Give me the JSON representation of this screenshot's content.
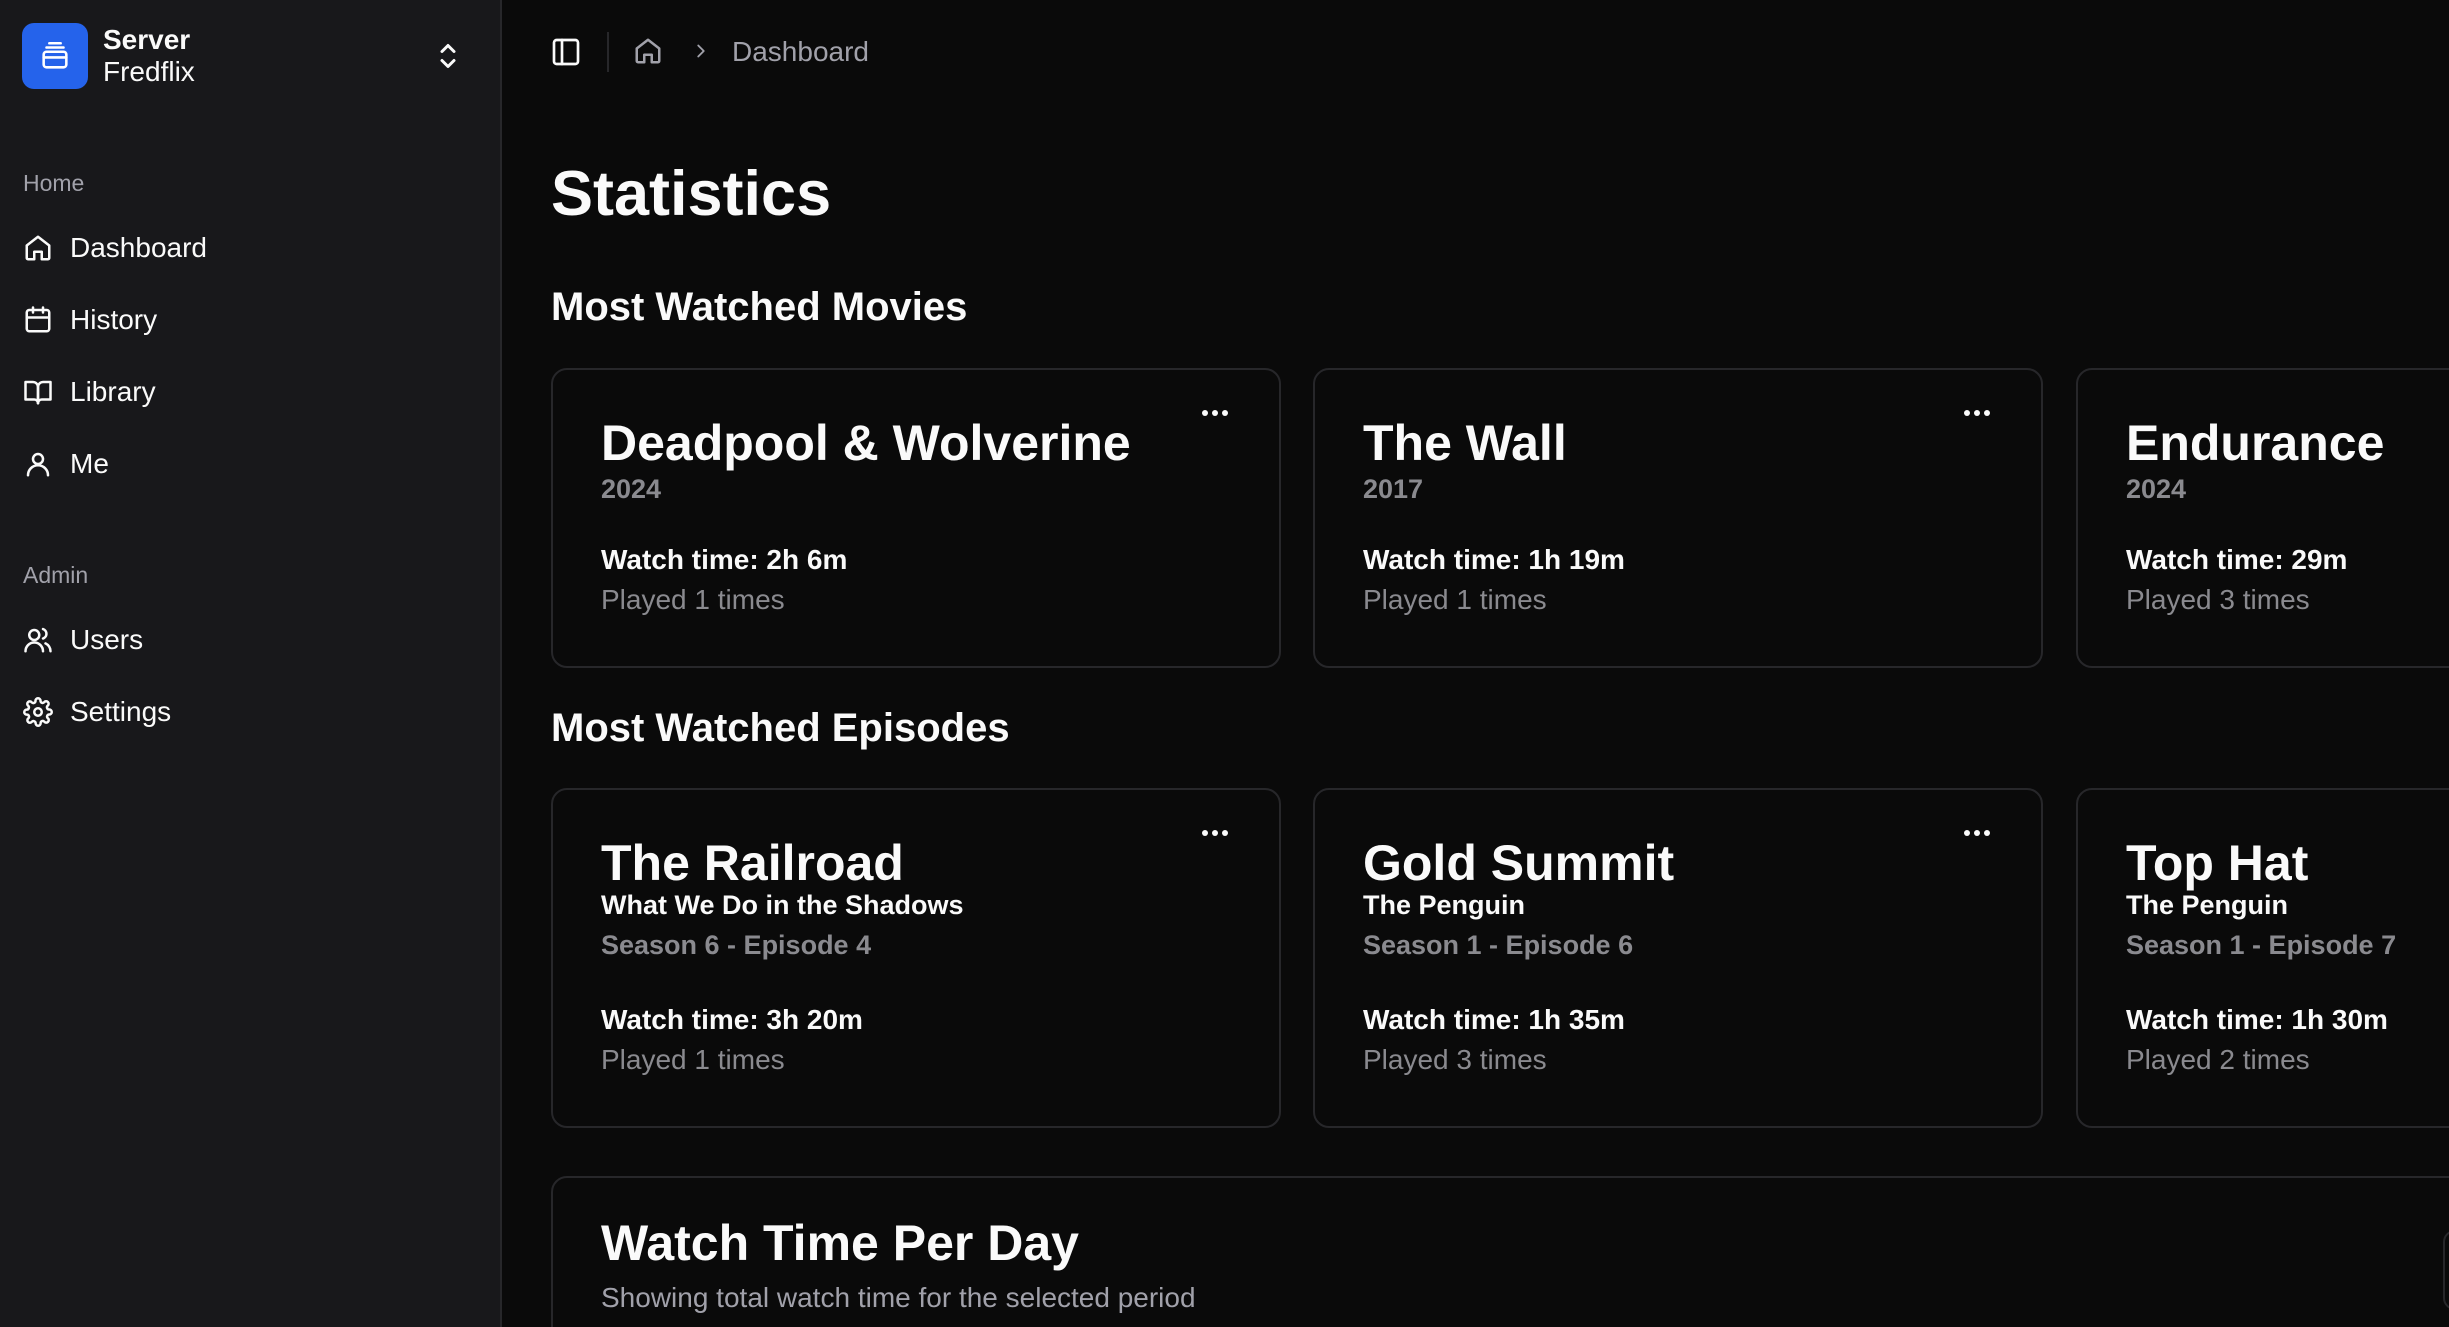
{
  "server": {
    "label": "Server",
    "name": "Fredflix"
  },
  "sidebar": {
    "home_group": "Home",
    "home_items": [
      {
        "label": "Dashboard",
        "icon": "home-icon"
      },
      {
        "label": "History",
        "icon": "calendar-icon"
      },
      {
        "label": "Library",
        "icon": "book-icon"
      },
      {
        "label": "Me",
        "icon": "user-icon"
      }
    ],
    "admin_group": "Admin",
    "admin_items": [
      {
        "label": "Users",
        "icon": "users-icon"
      },
      {
        "label": "Settings",
        "icon": "gear-icon"
      }
    ]
  },
  "breadcrumb": {
    "current": "Dashboard"
  },
  "page": {
    "title": "Statistics"
  },
  "movies": {
    "section_title": "Most Watched Movies",
    "items": [
      {
        "title": "Deadpool & Wolverine",
        "year": "2024",
        "watch_time": "Watch time: 2h 6m",
        "played": "Played 1 times"
      },
      {
        "title": "The Wall",
        "year": "2017",
        "watch_time": "Watch time: 1h 19m",
        "played": "Played 1 times"
      },
      {
        "title": "Endurance",
        "year": "2024",
        "watch_time": "Watch time: 29m",
        "played": "Played 3 times"
      }
    ]
  },
  "episodes": {
    "section_title": "Most Watched Episodes",
    "items": [
      {
        "title": "The Railroad",
        "show": "What We Do in the Shadows",
        "episode": "Season 6 - Episode 4",
        "watch_time": "Watch time: 3h 20m",
        "played": "Played 1 times"
      },
      {
        "title": "Gold Summit",
        "show": "The Penguin",
        "episode": "Season 1 - Episode 6",
        "watch_time": "Watch time: 1h 35m",
        "played": "Played 3 times"
      },
      {
        "title": "Top Hat",
        "show": "The Penguin",
        "episode": "Season 1 - Episode 7",
        "watch_time": "Watch time: 1h 30m",
        "played": "Played 2 times"
      }
    ]
  },
  "watch_time_chart": {
    "title": "Watch Time Per Day",
    "description": "Showing total watch time for the selected period"
  },
  "colors": {
    "accent": "#2563eb",
    "sidebar_bg": "#18181b",
    "page_bg": "#0a0a0a",
    "border": "#27272a",
    "muted_text": "#a1a1aa"
  }
}
